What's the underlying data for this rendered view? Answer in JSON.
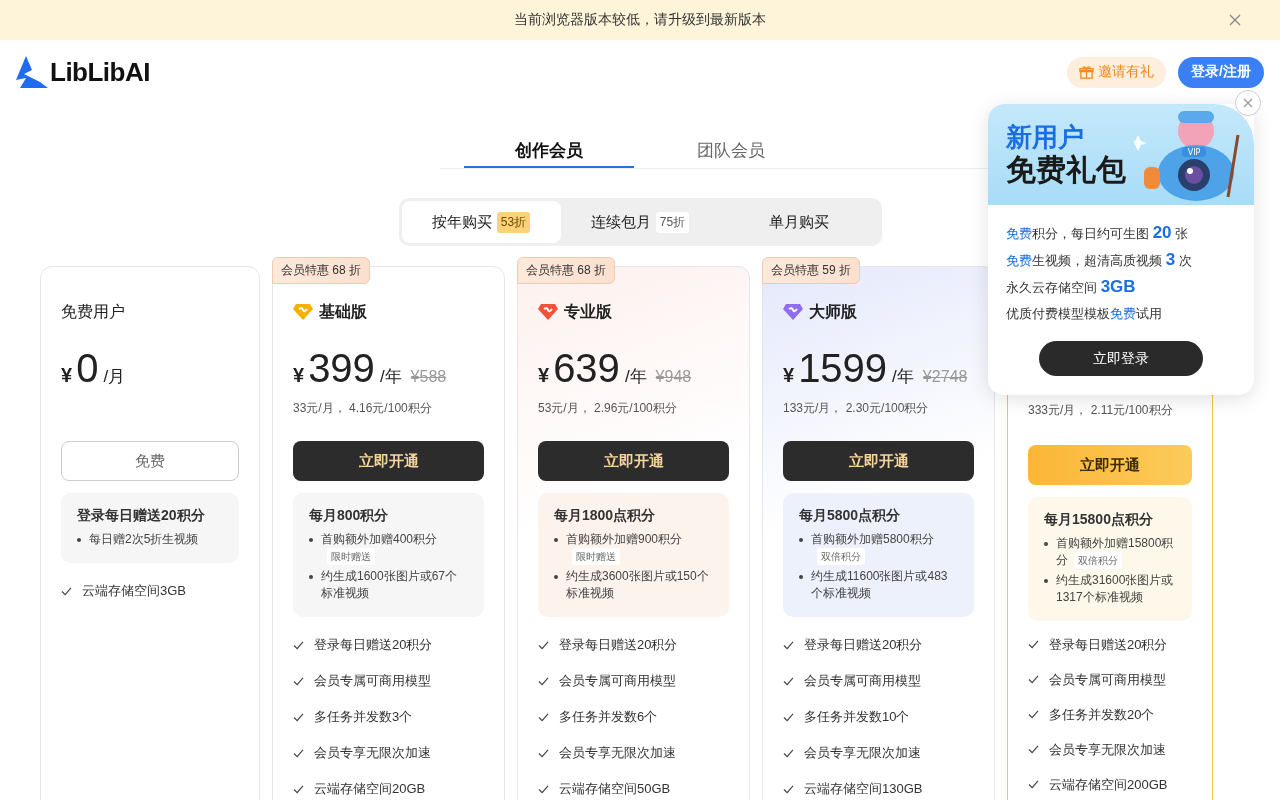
{
  "banner": {
    "text": "当前浏览器版本较低，请升级到最新版本"
  },
  "header": {
    "logo": "LibLibAI",
    "invite_button": "邀请有礼",
    "login_button": "登录/注册"
  },
  "tabs": [
    {
      "label": "创作会员",
      "selected": true
    },
    {
      "label": "团队会员",
      "selected": false
    }
  ],
  "billing_options": [
    {
      "label": "按年购买",
      "discount": "53折",
      "selected": true
    },
    {
      "label": "连续包月",
      "discount": "75折",
      "selected": false
    },
    {
      "label": "单月购买",
      "selected": false
    }
  ],
  "plans": [
    {
      "kind": "free",
      "highlighted": false,
      "name": "免费用户",
      "currency": "¥",
      "price": "0",
      "period": "/月",
      "button": "免费",
      "points_title": "登录每日赠送20积分",
      "points_items": [
        {
          "text": "每日赠2次5折生视频"
        }
      ],
      "features": [
        "云端存储空间3GB"
      ]
    },
    {
      "kind": "basic",
      "highlighted": false,
      "badge": "会员特惠 68 折",
      "name": "基础版",
      "currency": "¥",
      "price": "399",
      "period": "/年",
      "original_price": "¥588",
      "unit_price": "33元/月， 4.16元/100积分",
      "button": "立即开通",
      "points_title": "每月800积分",
      "points_items": [
        {
          "text": "首购额外加赠400积分",
          "tag": "限时赠送"
        },
        {
          "text": "约生成1600张图片或67个标准视频"
        }
      ],
      "features": [
        "登录每日赠送20积分",
        "会员专属可商用模型",
        "多任务并发数3个",
        "会员专享无限次加速",
        "云端存储空间20GB"
      ]
    },
    {
      "kind": "pro",
      "highlighted": false,
      "badge": "会员特惠 68 折",
      "name": "专业版",
      "currency": "¥",
      "price": "639",
      "period": "/年",
      "original_price": "¥948",
      "unit_price": "53元/月， 2.96元/100积分",
      "button": "立即开通",
      "points_title": "每月1800点积分",
      "points_items": [
        {
          "text": "首购额外加赠900积分",
          "tag": "限时赠送"
        },
        {
          "text": "约生成3600张图片或150个标准视频"
        }
      ],
      "features": [
        "登录每日赠送20积分",
        "会员专属可商用模型",
        "多任务并发数6个",
        "会员专享无限次加速",
        "云端存储空间50GB"
      ]
    },
    {
      "kind": "master",
      "highlighted": false,
      "badge": "会员特惠 59 折",
      "name": "大师版",
      "currency": "¥",
      "price": "1599",
      "period": "/年",
      "original_price": "¥2748",
      "unit_price": "133元/月， 2.30元/100积分",
      "button": "立即开通",
      "points_title": "每月5800点积分",
      "points_items": [
        {
          "text": "首购额外加赠5800积分",
          "tag": "双倍积分"
        },
        {
          "text": "约生成11600张图片或483个标准视频"
        }
      ],
      "features": [
        "登录每日赠送20积分",
        "会员专属可商用模型",
        "多任务并发数10个",
        "会员专享无限次加速",
        "云端存储空间130GB"
      ]
    },
    {
      "kind": "premium",
      "highlighted": true,
      "unit_price": "333元/月， 2.11元/100积分",
      "button": "立即开通",
      "points_title": "每月15800点积分",
      "points_items": [
        {
          "text": "首购额外加赠15800积分",
          "tag": "双倍积分"
        },
        {
          "text": "约生成31600张图片或1317个标准视频"
        }
      ],
      "features": [
        "登录每日赠送20积分",
        "会员专属可商用模型",
        "多任务并发数20个",
        "会员专享无限次加速",
        "云端存储空间200GB"
      ]
    }
  ],
  "promo_popup": {
    "title_top": "新用户",
    "title_bottom": "免费礼包",
    "illustration_label": "VIP",
    "lines": [
      {
        "parts": [
          {
            "text": "免费",
            "kind": "accent"
          },
          {
            "text": "积分，每日约可生图 ",
            "kind": "plain"
          },
          {
            "text": "20",
            "kind": "number"
          },
          {
            "text": " 张",
            "kind": "plain"
          }
        ]
      },
      {
        "parts": [
          {
            "text": "免费",
            "kind": "accent"
          },
          {
            "text": "生视频，超清高质视频 ",
            "kind": "plain"
          },
          {
            "text": "3",
            "kind": "number"
          },
          {
            "text": " 次",
            "kind": "plain"
          }
        ]
      },
      {
        "parts": [
          {
            "text": "永久云存储空间 ",
            "kind": "plain"
          },
          {
            "text": "3GB",
            "kind": "number"
          }
        ]
      },
      {
        "parts": [
          {
            "text": "优质付费模型模板",
            "kind": "plain"
          },
          {
            "text": "免费",
            "kind": "accent"
          },
          {
            "text": "试用",
            "kind": "plain"
          }
        ]
      }
    ],
    "button": "立即登录"
  }
}
